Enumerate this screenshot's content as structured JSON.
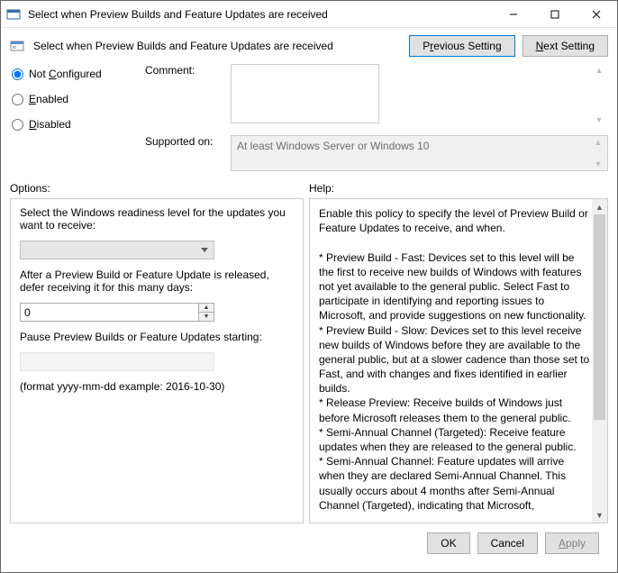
{
  "titlebar": {
    "title": "Select when Preview Builds and Feature Updates are received"
  },
  "header": {
    "title": "Select when Preview Builds and Feature Updates are received"
  },
  "nav": {
    "prev_pre": "P",
    "prev_u": "r",
    "prev_post": "evious Setting",
    "next_pre": "",
    "next_u": "N",
    "next_post": "ext Setting"
  },
  "radios": {
    "not_configured_label": "Not ",
    "not_configured_u": "C",
    "not_configured_post": "onfigured",
    "enabled_u": "E",
    "enabled_post": "nabled",
    "disabled_u": "D",
    "disabled_post": "isabled"
  },
  "labels": {
    "comment": "Comment:",
    "supported": "Supported on:",
    "options": "Options:",
    "help": "Help:"
  },
  "supported_text": "At least Windows Server or Windows 10",
  "options": {
    "line1": "Select the Windows readiness level for the updates you want to receive:",
    "line2": "After a Preview Build or Feature Update is released, defer receiving it for this many days:",
    "spinner_value": "0",
    "line3": "Pause Preview Builds or Feature Updates starting:",
    "line4": "(format yyyy-mm-dd example: 2016-10-30)"
  },
  "help_text": "Enable this policy to specify the level of Preview Build or Feature Updates to receive, and when.\n\n* Preview Build - Fast: Devices set to this level will be the first to receive new builds of Windows with features not yet available to the general public. Select Fast to participate in identifying and reporting issues to Microsoft, and provide suggestions on new functionality.\n* Preview Build - Slow: Devices set to this level receive new builds of Windows before they are available to the general public, but at a slower cadence than those set to Fast, and with changes and fixes identified in earlier builds.\n* Release Preview: Receive builds of Windows just before Microsoft releases them to the general public.\n* Semi-Annual Channel (Targeted): Receive feature updates when they are released to the general public.\n* Semi-Annual Channel: Feature updates will arrive when they are declared Semi-Annual Channel. This usually occurs about 4 months after Semi-Annual Channel (Targeted), indicating that Microsoft, Independent Software Vendors (ISVs), partners and customer believe that the release is ready for broad deployment.",
  "footer": {
    "ok": "OK",
    "cancel": "Cancel",
    "apply_pre": "",
    "apply_u": "A",
    "apply_post": "pply"
  }
}
